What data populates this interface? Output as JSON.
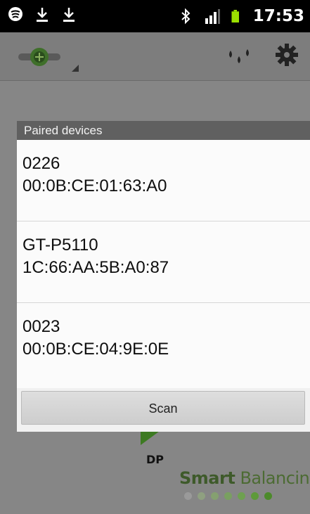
{
  "status_bar": {
    "time": "17:53",
    "icons": [
      "cast-icon",
      "download-icon",
      "download-icon",
      "bluetooth-icon",
      "signal-icon",
      "battery-icon"
    ]
  },
  "action_bar": {
    "icons": [
      "app-logo-icon",
      "drops-icon",
      "gear-icon"
    ]
  },
  "dialog": {
    "title": "Paired devices",
    "devices": [
      {
        "name": "0226",
        "address": "00:0B:CE:01:63:A0"
      },
      {
        "name": "GT-P5110",
        "address": "1C:66:AA:5B:A0:87"
      },
      {
        "name": "0023",
        "address": "00:0B:CE:04:9E:0E"
      }
    ],
    "scan_label": "Scan"
  },
  "background": {
    "dp_label": "DP",
    "brand_bold": "Smart",
    "brand_light": "Balancing",
    "colors": {
      "brand": "#3e5a2a",
      "accent_green": "#4c8a2a"
    }
  }
}
